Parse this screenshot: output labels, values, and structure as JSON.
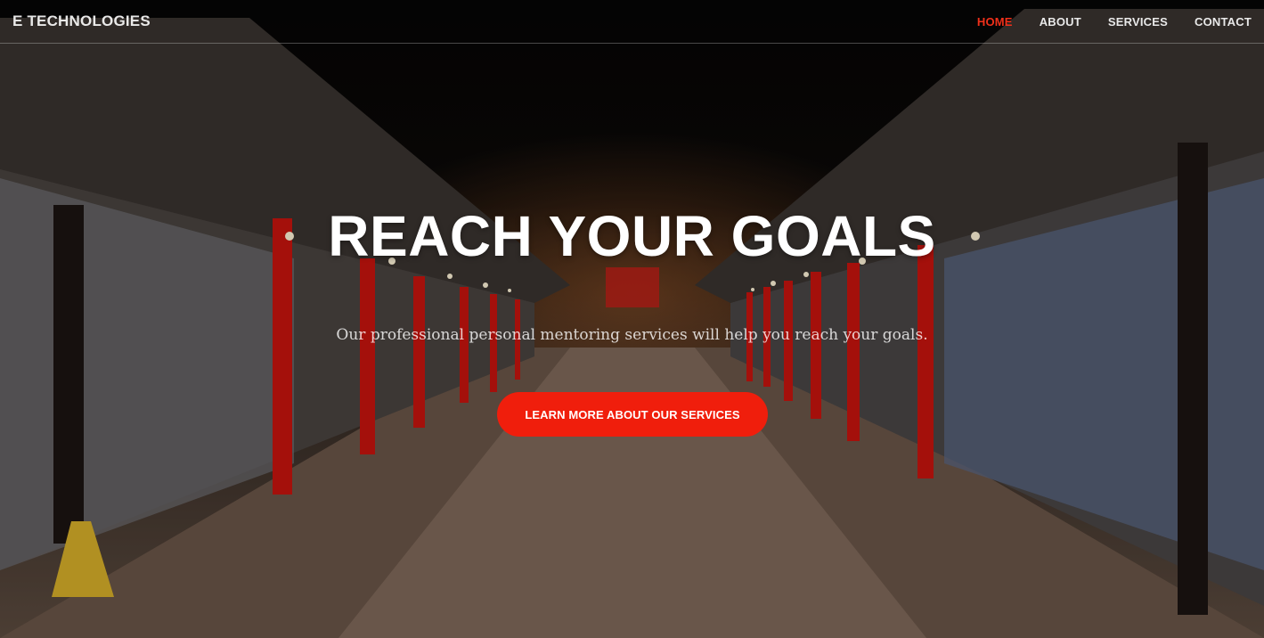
{
  "navbar": {
    "brand": "E TECHNOLOGIES",
    "links": [
      {
        "label": "HOME",
        "active": true
      },
      {
        "label": "ABOUT",
        "active": false
      },
      {
        "label": "SERVICES",
        "active": false
      },
      {
        "label": "CONTACT",
        "active": false
      }
    ]
  },
  "hero": {
    "headline": "REACH YOUR GOALS",
    "subtitle": "Our professional personal mentoring services will help you reach your goals.",
    "cta_label": "LEARN MORE ABOUT OUR SERVICES"
  },
  "colors": {
    "accent": "#f01e0c",
    "active_link": "#f0301a",
    "text": "#ffffff"
  }
}
